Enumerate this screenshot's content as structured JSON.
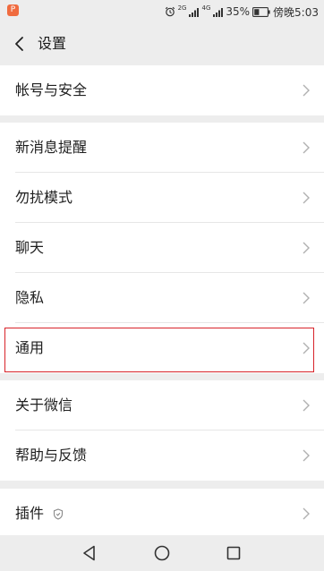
{
  "status_bar": {
    "app_badge": "P",
    "network_1": "2G",
    "network_2": "4G",
    "battery_percent": "35%",
    "time": "傍晚5:03"
  },
  "header": {
    "title": "设置"
  },
  "groups": [
    {
      "items": [
        {
          "label": "帐号与安全"
        }
      ]
    },
    {
      "items": [
        {
          "label": "新消息提醒"
        },
        {
          "label": "勿扰模式"
        },
        {
          "label": "聊天"
        },
        {
          "label": "隐私"
        },
        {
          "label": "通用"
        }
      ]
    },
    {
      "items": [
        {
          "label": "关于微信"
        },
        {
          "label": "帮助与反馈"
        }
      ]
    },
    {
      "items": [
        {
          "label": "插件"
        }
      ]
    }
  ],
  "icons": {
    "back": "back-arrow-icon",
    "chevron": "chevron-right-icon",
    "plugin_badge": "shield-icon",
    "alarm": "alarm-icon",
    "battery": "battery-icon",
    "nav_back": "triangle-back-icon",
    "nav_home": "circle-home-icon",
    "nav_recents": "square-recents-icon"
  },
  "colors": {
    "background": "#ededed",
    "surface": "#ffffff",
    "highlight_border": "#d8232a",
    "app_badge": "#f06b3f"
  }
}
